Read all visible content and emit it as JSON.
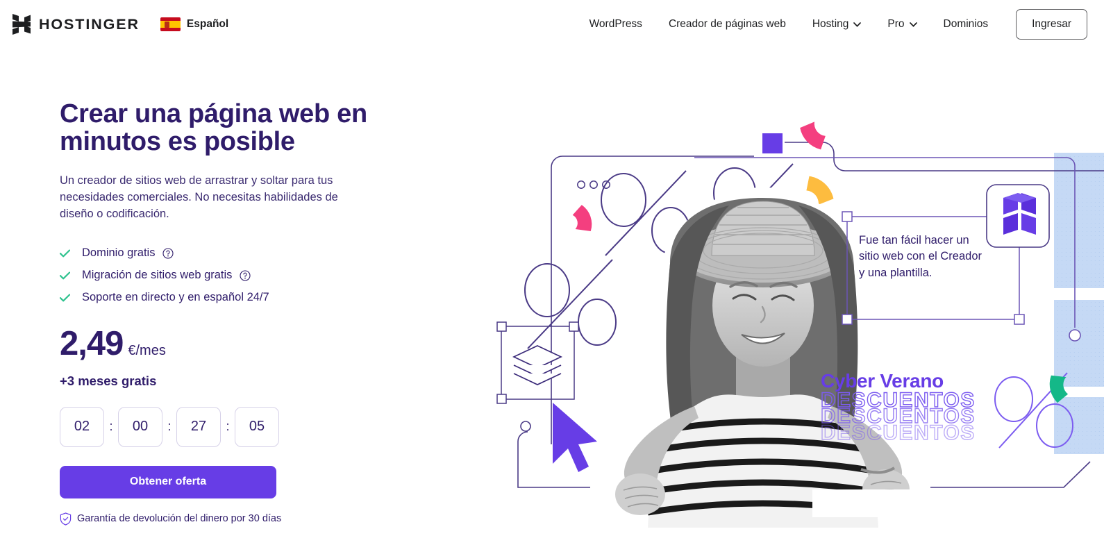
{
  "brand": {
    "name": "HOSTINGER",
    "logo_icon": "hostinger-h-logo"
  },
  "language": {
    "label": "Español",
    "flag_icon": "spain-flag-icon"
  },
  "nav": {
    "items": [
      {
        "label": "WordPress",
        "has_dropdown": false
      },
      {
        "label": "Creador de páginas web",
        "has_dropdown": false
      },
      {
        "label": "Hosting",
        "has_dropdown": true
      },
      {
        "label": "Pro",
        "has_dropdown": true
      },
      {
        "label": "Dominios",
        "has_dropdown": false
      }
    ],
    "login_label": "Ingresar"
  },
  "hero": {
    "headline": "Crear una página web en minutos es posible",
    "subtitle": "Un creador de sitios web de arrastrar y soltar para tus necesidades comerciales. No necesitas habilidades de diseño o codificación.",
    "features": [
      {
        "label": "Dominio gratis",
        "has_help": true
      },
      {
        "label": "Migración de sitios web gratis",
        "has_help": true
      },
      {
        "label": "Soporte en directo y en español 24/7",
        "has_help": false
      }
    ],
    "price": "2,49",
    "price_unit": "€/mes",
    "bonus": "+3 meses gratis",
    "countdown": {
      "days": "02",
      "hours": "00",
      "minutes": "27",
      "seconds": "05",
      "separator": ":"
    },
    "cta_label": "Obtener oferta",
    "guarantee": "Garantía de devolución del dinero por 30 días"
  },
  "illustration": {
    "testimonial": "Fue tan fácil hacer un sitio web con el Creador y una plantilla.",
    "campaign_title": "Cyber Verano",
    "campaign_word": "DESCUENTOS",
    "badge_icon": "hostinger-cube-icon",
    "layers_icon": "layers-icon",
    "cursor_icon": "mouse-cursor-icon"
  },
  "colors": {
    "heading_purple": "#2F1C6A",
    "accent_purple": "#673DE6",
    "outline_purple": "#7C5CF0",
    "check_teal": "#2EC28E",
    "accent_teal": "#14B888",
    "accent_pink": "#F43F7F",
    "accent_yellow": "#FDBC3F",
    "bar_blue": "#C5D9F5",
    "text_dark": "#1D1E20"
  }
}
